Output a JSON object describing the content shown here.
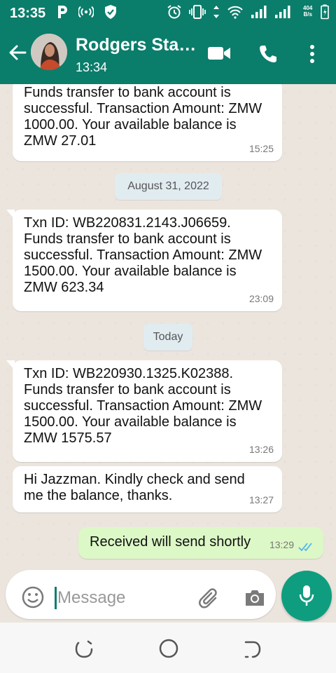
{
  "status_bar": {
    "time": "13:35",
    "network_speed_value": "404",
    "network_speed_unit": "B/s",
    "icons": [
      "parking-icon",
      "hotspot-icon",
      "shield-icon",
      "alarm-icon",
      "vibrate-icon",
      "data-arrows-icon",
      "wifi-icon",
      "signal-icon",
      "signal-icon",
      "battery-icon"
    ]
  },
  "header": {
    "contact_name": "Rodgers Sta…",
    "last_seen": "13:34",
    "icons": [
      "back-arrow-icon",
      "video-call-icon",
      "phone-call-icon",
      "more-options-icon"
    ]
  },
  "messages": [
    {
      "direction": "in",
      "text": "Funds transfer to bank account is successful. Transaction Amount: ZMW 1000.00. Your available balance is ZMW 27.01",
      "time": "15:25"
    },
    {
      "type": "date",
      "label": "August 31, 2022"
    },
    {
      "direction": "in",
      "text": "Txn ID: WB220831.2143.J06659. Funds transfer to bank account is successful. Transaction Amount: ZMW 1500.00. Your available balance is ZMW 623.34",
      "time": "23:09"
    },
    {
      "type": "date",
      "label": "Today"
    },
    {
      "direction": "in",
      "text": "Txn ID: WB220930.1325.K02388. Funds transfer to bank account is successful. Transaction Amount: ZMW 1500.00. Your available balance is ZMW 1575.57",
      "time": "13:26"
    },
    {
      "direction": "in",
      "text": "Hi Jazzman. Kindly check and send me the balance, thanks.",
      "time": "13:27"
    },
    {
      "direction": "out",
      "text": "Received will send shortly",
      "time": "13:29",
      "status": "read"
    }
  ],
  "composer": {
    "placeholder": "Message",
    "icons": [
      "emoji-icon",
      "attach-icon",
      "camera-icon",
      "mic-icon"
    ]
  },
  "colors": {
    "header": "#0b7d6b",
    "chat_background": "#ece5dd",
    "incoming_bubble": "#ffffff",
    "outgoing_bubble": "#dcf8c6",
    "date_chip": "#e1ecf1",
    "mic_button": "#0f9d7f",
    "read_ticks": "#4fb6ec"
  }
}
